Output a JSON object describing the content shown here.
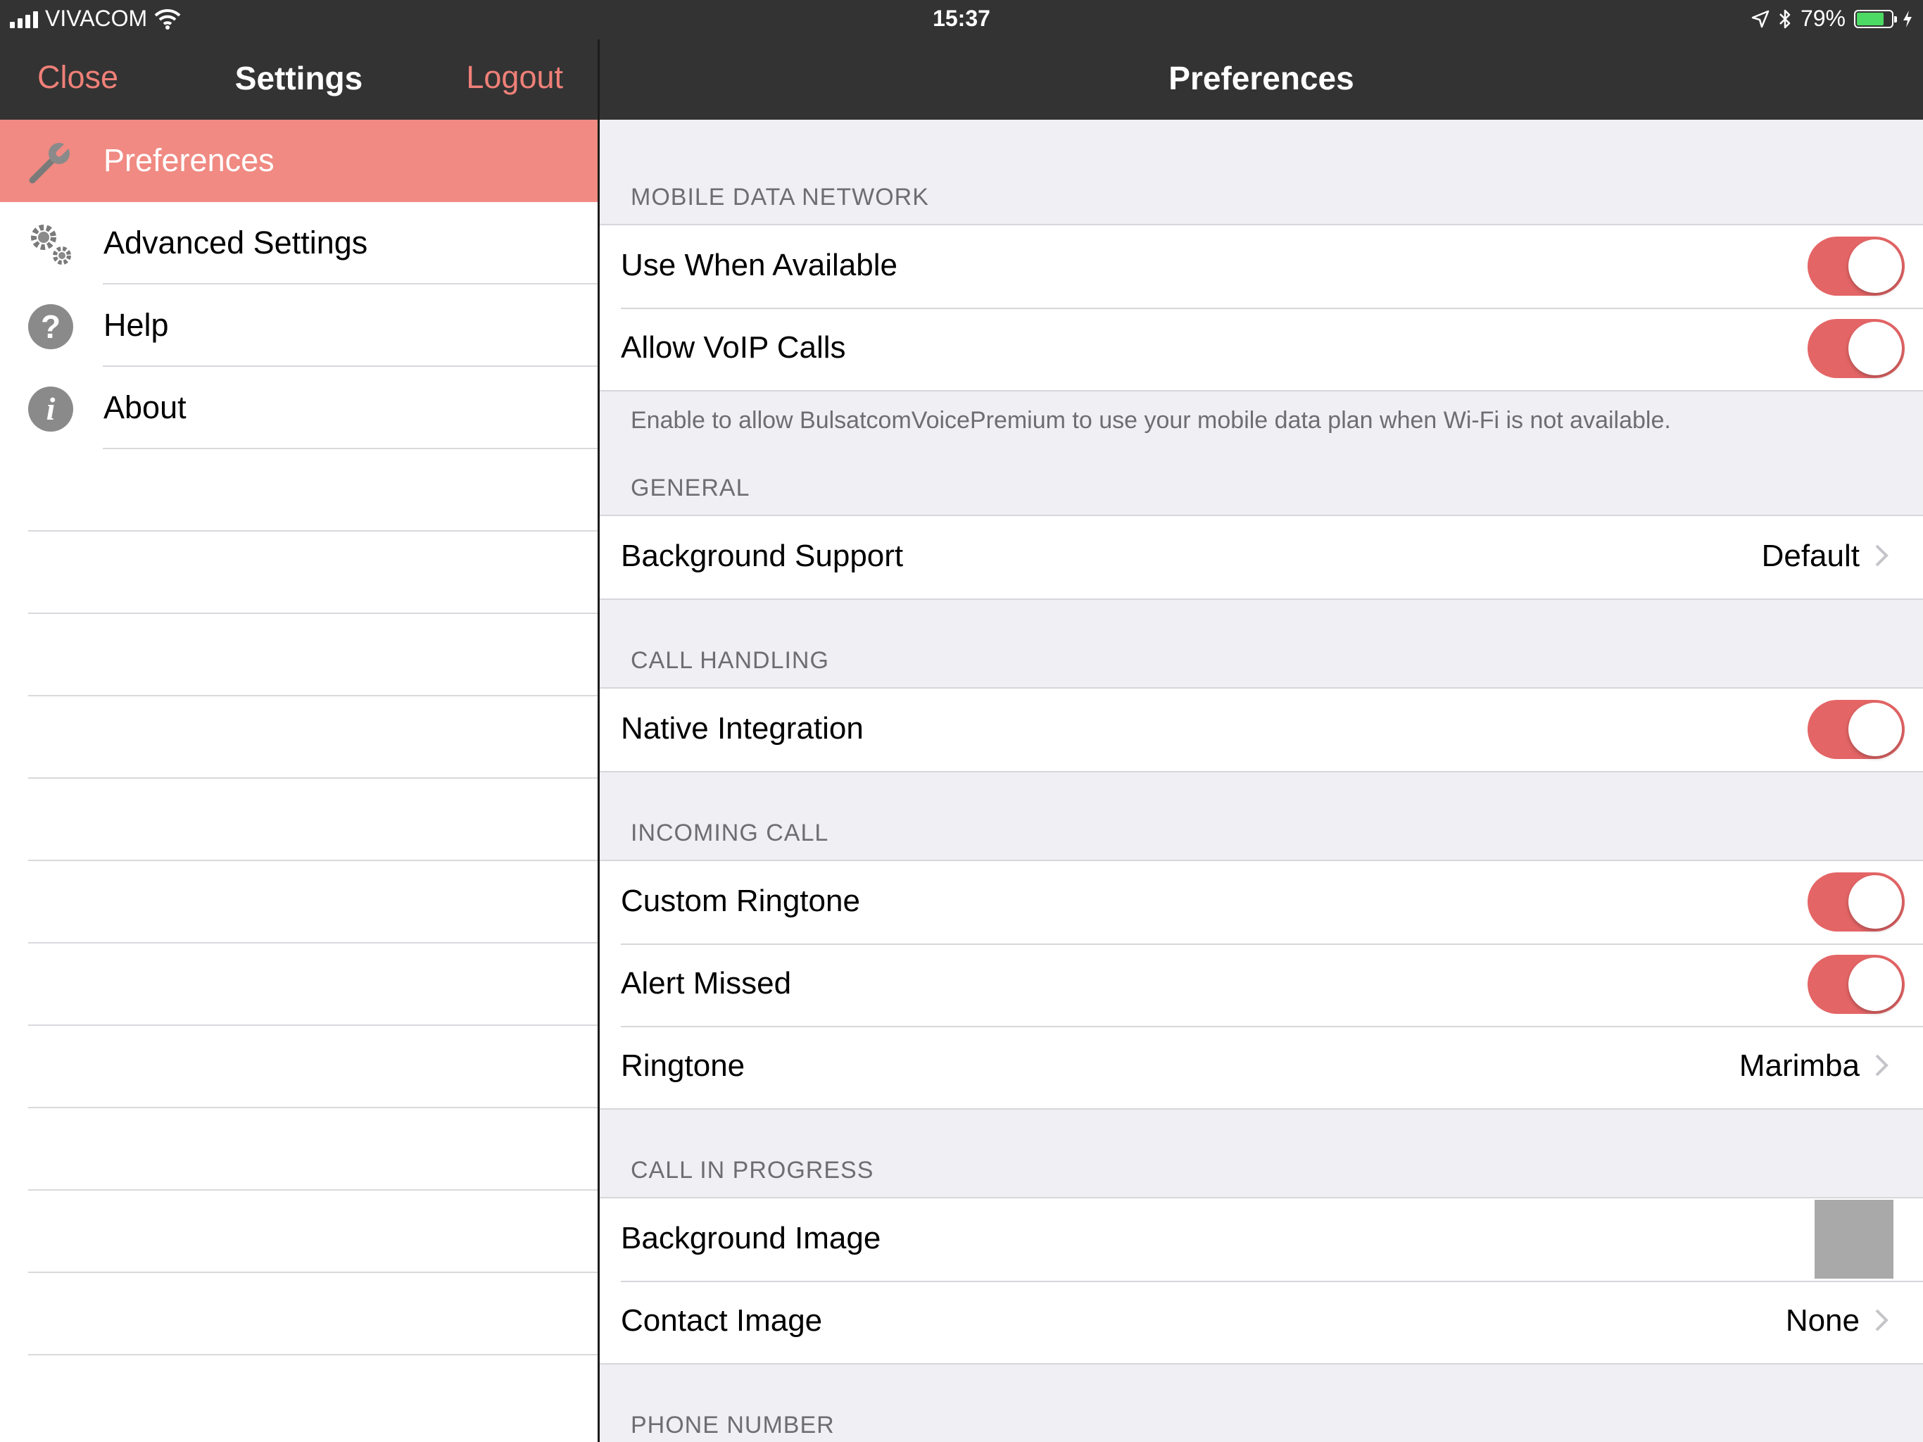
{
  "status_bar": {
    "carrier": "VIVACOM",
    "time": "15:37",
    "battery_percent": "79%",
    "battery_level": 0.79,
    "battery_color": "#4cd964"
  },
  "colors": {
    "accent": "#f08a82",
    "toggle_on": "#e46566",
    "nav_bg": "#333333"
  },
  "sidebar": {
    "nav": {
      "close_label": "Close",
      "title": "Settings",
      "logout_label": "Logout"
    },
    "items": [
      {
        "label": "Preferences",
        "icon": "wrench-icon",
        "active": true
      },
      {
        "label": "Advanced Settings",
        "icon": "gears-icon",
        "active": false
      },
      {
        "label": "Help",
        "icon": "help-icon",
        "active": false
      },
      {
        "label": "About",
        "icon": "info-icon",
        "active": false
      }
    ]
  },
  "main": {
    "title": "Preferences",
    "sections": {
      "mobile_data": {
        "header": "MOBILE DATA NETWORK",
        "rows": [
          {
            "label": "Use When Available",
            "toggle": true
          },
          {
            "label": "Allow VoIP Calls",
            "toggle": true
          }
        ],
        "footer": "Enable to allow BulsatcomVoicePremium to use your mobile data plan when Wi-Fi is not available."
      },
      "general": {
        "header": "GENERAL",
        "rows": [
          {
            "label": "Background Support",
            "value": "Default"
          }
        ]
      },
      "call_handling": {
        "header": "CALL HANDLING",
        "rows": [
          {
            "label": "Native Integration",
            "toggle": true
          }
        ]
      },
      "incoming_call": {
        "header": "INCOMING CALL",
        "rows": [
          {
            "label": "Custom Ringtone",
            "toggle": true
          },
          {
            "label": "Alert Missed",
            "toggle": true
          },
          {
            "label": "Ringtone",
            "value": "Marimba"
          }
        ]
      },
      "call_in_progress": {
        "header": "CALL IN PROGRESS",
        "rows": [
          {
            "label": "Background Image"
          },
          {
            "label": "Contact Image",
            "value": "None"
          }
        ]
      },
      "phone_number": {
        "header": "PHONE NUMBER"
      }
    }
  }
}
